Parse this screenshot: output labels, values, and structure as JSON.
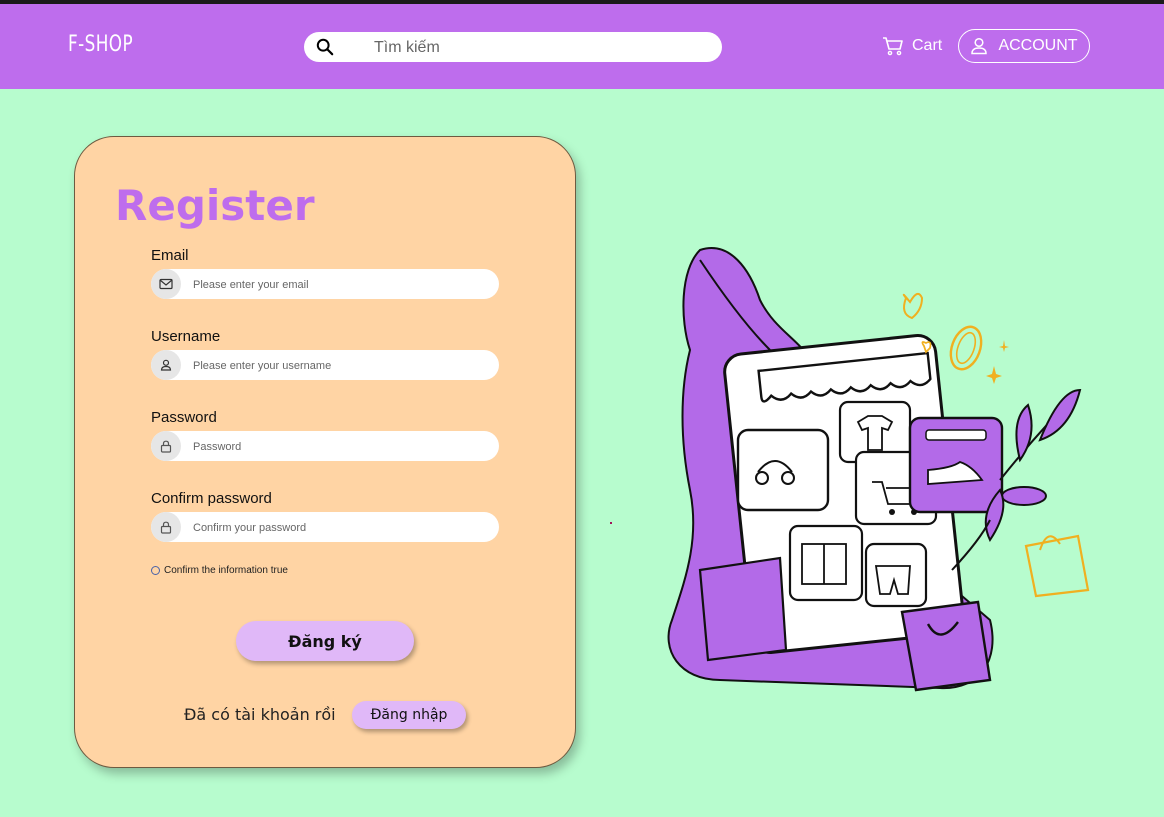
{
  "header": {
    "logo": "F-SHOP",
    "search_placeholder": "Tìm kiếm",
    "cart_label": "Cart",
    "account_label": "ACCOUNT"
  },
  "register": {
    "title": "Register",
    "email": {
      "label": "Email",
      "placeholder": "Please enter your email"
    },
    "username": {
      "label": "Username",
      "placeholder": "Please enter your username"
    },
    "password": {
      "label": "Password",
      "placeholder": "Password"
    },
    "confirm_password": {
      "label": "Confirm password",
      "placeholder": "Confirm your password"
    },
    "confirm_text": "Confirm the information true",
    "submit_label": "Đăng ký",
    "already_text": "Đã có tài khoản rồi",
    "login_label": "Đăng nhập"
  },
  "colors": {
    "header": "#be6ded",
    "background": "#b7fcce",
    "card": "#ffd4a4",
    "title": "#be6ded",
    "button": "#e0b8f8"
  },
  "icons": [
    "search-icon",
    "cart-icon",
    "user-icon",
    "mail-icon",
    "lock-icon"
  ]
}
